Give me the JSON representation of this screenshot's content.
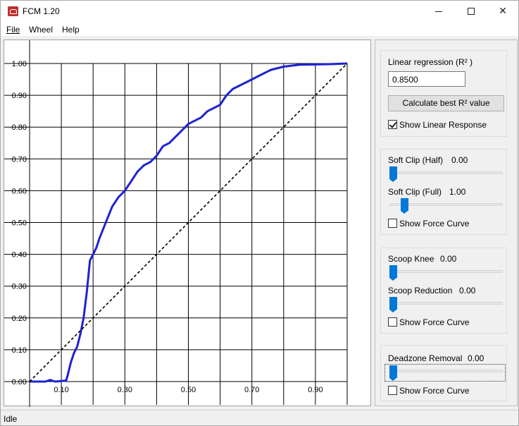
{
  "window": {
    "title": "FCM 1.20"
  },
  "menu": {
    "file": "File",
    "wheel": "Wheel",
    "help": "Help"
  },
  "regression": {
    "label": "Linear regression (R² )",
    "value": "0.8500",
    "button": "Calculate best R² value",
    "show_linear": "Show Linear Response",
    "show_linear_checked": true
  },
  "softclip": {
    "half_label": "Soft Clip (Half)",
    "half_value": "0.00",
    "half_level": 0.0,
    "full_label": "Soft Clip (Full)",
    "full_value": "1.00",
    "full_level": 0.1,
    "show_force": "Show Force Curve",
    "show_force_checked": false
  },
  "scoop": {
    "knee_label": "Scoop Knee",
    "knee_value": "0.00",
    "knee_level": 0.0,
    "reduction_label": "Scoop Reduction",
    "reduction_value": "0.00",
    "reduction_level": 0.0,
    "show_force": "Show Force Curve",
    "show_force_checked": false
  },
  "deadzone": {
    "label": "Deadzone Removal",
    "value": "0.00",
    "level": 0.0,
    "show_force": "Show Force Curve",
    "show_force_checked": false
  },
  "status": {
    "text": "Idle"
  },
  "colors": {
    "curve": "#1e22d0",
    "accent": "#0078d7",
    "diagonal": "#000000"
  },
  "chart_data": {
    "type": "line",
    "xlim": [
      0,
      1
    ],
    "ylim": [
      0,
      1
    ],
    "grid": true,
    "x_tick_labels": [
      "0.10",
      "0.30",
      "0.50",
      "0.70",
      "0.90"
    ],
    "x_tick_values": [
      0.1,
      0.3,
      0.5,
      0.7,
      0.9
    ],
    "y_tick_labels": [
      "0.00",
      "0.10",
      "0.20",
      "0.30",
      "0.40",
      "0.50",
      "0.60",
      "0.70",
      "0.80",
      "0.90",
      "1.00"
    ],
    "y_tick_values": [
      0,
      0.1,
      0.2,
      0.3,
      0.4,
      0.5,
      0.6,
      0.7,
      0.8,
      0.9,
      1.0
    ],
    "series": [
      {
        "style": "solid",
        "points": [
          [
            0,
            0
          ],
          [
            0.05,
            0
          ],
          [
            0.065,
            0.005
          ],
          [
            0.08,
            0
          ],
          [
            0.115,
            0.003
          ],
          [
            0.12,
            0.02
          ],
          [
            0.13,
            0.06
          ],
          [
            0.14,
            0.09
          ],
          [
            0.15,
            0.11
          ],
          [
            0.16,
            0.15
          ],
          [
            0.17,
            0.2
          ],
          [
            0.18,
            0.28
          ],
          [
            0.19,
            0.38
          ],
          [
            0.2,
            0.4
          ],
          [
            0.21,
            0.42
          ],
          [
            0.22,
            0.45
          ],
          [
            0.24,
            0.5
          ],
          [
            0.26,
            0.55
          ],
          [
            0.28,
            0.58
          ],
          [
            0.3,
            0.6
          ],
          [
            0.32,
            0.63
          ],
          [
            0.34,
            0.66
          ],
          [
            0.36,
            0.68
          ],
          [
            0.38,
            0.69
          ],
          [
            0.4,
            0.71
          ],
          [
            0.42,
            0.74
          ],
          [
            0.44,
            0.75
          ],
          [
            0.46,
            0.77
          ],
          [
            0.48,
            0.79
          ],
          [
            0.5,
            0.81
          ],
          [
            0.52,
            0.82
          ],
          [
            0.54,
            0.83
          ],
          [
            0.56,
            0.85
          ],
          [
            0.6,
            0.87
          ],
          [
            0.62,
            0.9
          ],
          [
            0.64,
            0.92
          ],
          [
            0.68,
            0.94
          ],
          [
            0.7,
            0.95
          ],
          [
            0.72,
            0.96
          ],
          [
            0.74,
            0.97
          ],
          [
            0.76,
            0.98
          ],
          [
            0.8,
            0.99
          ],
          [
            0.85,
            0.996
          ],
          [
            0.9,
            0.997
          ],
          [
            0.95,
            0.998
          ],
          [
            1.0,
            1.0
          ]
        ]
      },
      {
        "style": "dashed",
        "points": [
          [
            0,
            0
          ],
          [
            1,
            1
          ]
        ]
      }
    ]
  }
}
